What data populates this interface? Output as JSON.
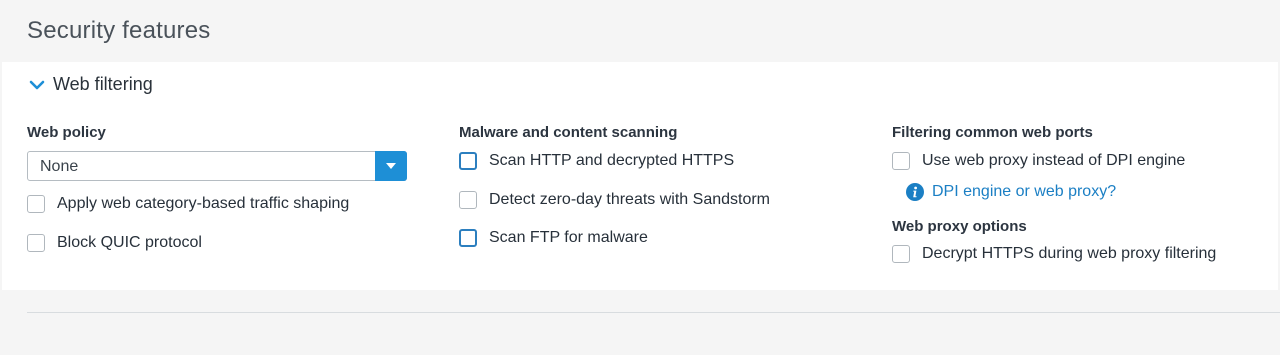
{
  "header": {
    "title": "Security features"
  },
  "section": {
    "label": "Web filtering"
  },
  "web_policy": {
    "title": "Web policy",
    "select_value": "None",
    "checkboxes": [
      {
        "label": "Apply web category-based traffic shaping",
        "checked": false
      },
      {
        "label": "Block QUIC protocol",
        "checked": false
      }
    ]
  },
  "malware": {
    "title": "Malware and content scanning",
    "checkboxes": [
      {
        "label": "Scan HTTP and decrypted HTTPS",
        "checked": false
      },
      {
        "label": "Detect zero-day threats with Sandstorm",
        "checked": false
      },
      {
        "label": "Scan FTP for malware",
        "checked": false
      }
    ]
  },
  "ports": {
    "title": "Filtering common web ports",
    "checkboxes": [
      {
        "label": "Use web proxy instead of DPI engine",
        "checked": false
      }
    ],
    "info_link": "DPI engine or web proxy?"
  },
  "proxy_options": {
    "title": "Web proxy options",
    "checkboxes": [
      {
        "label": "Decrypt HTTPS during web proxy filtering",
        "checked": false
      }
    ]
  },
  "colors": {
    "accent": "#1e8fd6",
    "link": "#1b7fc4",
    "panel_bg": "#ffffff",
    "page_bg": "#f5f5f5"
  },
  "icons": {
    "section_toggle": "chevron-down-icon",
    "select_arrow": "caret-down-icon",
    "info": "info-icon"
  }
}
